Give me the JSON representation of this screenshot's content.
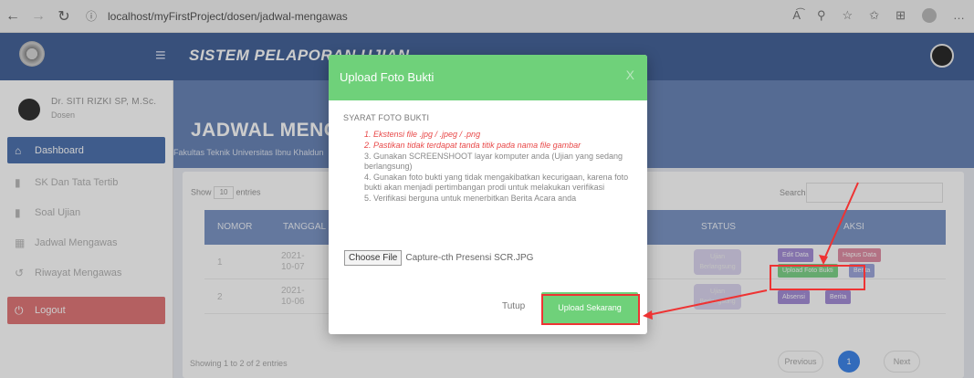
{
  "browser": {
    "back": "←",
    "forward": "→",
    "reload": "↻",
    "info": "ⓘ",
    "url": "localhost/myFirstProject/dosen/jadwal-mengawas"
  },
  "header": {
    "app_title": "SISTEM PELAPORAN UJIAN",
    "menu_icon": "≡"
  },
  "sidebar": {
    "user_name": "Dr. SITI RIZKI SP, M.Sc.",
    "user_role": "Dosen",
    "items": [
      {
        "icon": "⌂",
        "label": "Dashboard"
      },
      {
        "icon": "▮",
        "label": "SK Dan Tata Tertib"
      },
      {
        "icon": "▮",
        "label": "Soal Ujian"
      },
      {
        "icon": "▦",
        "label": "Jadwal Mengawas"
      },
      {
        "icon": "↺",
        "label": "Riwayat Mengawas"
      }
    ],
    "logout": {
      "icon": "⏻",
      "label": "Logout"
    }
  },
  "main": {
    "title": "JADWAL MENGAWAS",
    "subtitle": "Fakultas Teknik Universitas Ibnu Khaldun",
    "show_label": "Show",
    "show_value": "10",
    "entries_label": "entries",
    "search_label": "Search:",
    "table": {
      "headers": [
        "NOMOR",
        "TANGGAL",
        "STATUS",
        "AKSI"
      ],
      "rows": [
        {
          "no": "1",
          "date": "2021-10-07",
          "status": "Ujian Berlangsung",
          "actions": [
            "Edit Data",
            "Hapus Data",
            "Upload Foto Bukti",
            "Berita"
          ]
        },
        {
          "no": "2",
          "date": "2021-10-06",
          "status": "Ujian Berlangsung",
          "actions": [
            "Absensi",
            "Berita"
          ]
        }
      ]
    },
    "showing": "Showing 1 to 2 of 2 entries",
    "pagination": {
      "prev": "Previous",
      "current": "1",
      "next": "Next"
    }
  },
  "modal": {
    "title": "Upload Foto Bukti",
    "close": "X",
    "requirements_title": "SYARAT FOTO BUKTI",
    "requirements": [
      "1. Ekstensi file .jpg / .jpeg / .png",
      "2. Pastikan tidak terdapat tanda titik pada nama file gambar",
      "3. Gunakan SCREENSHOOT layar komputer anda (Ujian yang sedang berlangsung)",
      "4. Gunakan foto bukti yang tidak mengakibatkan kecurigaan, karena foto bukti akan menjadi pertimbangan prodi untuk melakukan verifikasi",
      "5. Verifikasi berguna untuk menerbitkan Berita Acara anda"
    ],
    "choose_file": "Choose File",
    "file_name": "Capture-cth Presensi SCR.JPG",
    "close_button": "Tutup",
    "upload_button": "Upload Sekarang"
  },
  "colors": {
    "topbar": "#46659a",
    "hero": "#6b86b8",
    "modal_accent": "#6fd17a",
    "danger": "#e2787a",
    "annotation": "#ee3333"
  }
}
